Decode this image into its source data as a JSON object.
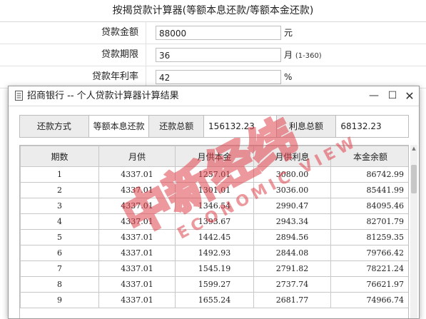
{
  "page": {
    "title": "按揭贷款计算器(等额本息还款/等额本金还款)"
  },
  "form": {
    "amount": {
      "label": "贷款金额",
      "value": "88000",
      "unit": "元"
    },
    "term": {
      "label": "贷款期限",
      "value": "36",
      "unit": "月",
      "hint": "(1-360)"
    },
    "rate": {
      "label": "贷款年利率",
      "value": "42",
      "unit": "%"
    }
  },
  "dialog": {
    "title": "招商银行 -- 个人贷款计算器计算结果",
    "minimize": "—",
    "maximize": "☐",
    "close": "✕",
    "summary": {
      "method_label": "还款方式",
      "method_value": "等额本息还款",
      "total_label": "还款总额",
      "total_value": "156132.23",
      "interest_label": "利息总额",
      "interest_value": "68132.23"
    },
    "table": {
      "headers": [
        "期数",
        "月供",
        "月供本金",
        "月供利息",
        "本金余额"
      ],
      "rows": [
        [
          "1",
          "4337.01",
          "1257.01",
          "3080.00",
          "86742.99"
        ],
        [
          "2",
          "4337.01",
          "1301.01",
          "3036.00",
          "85441.99"
        ],
        [
          "3",
          "4337.01",
          "1346.54",
          "2990.47",
          "84095.46"
        ],
        [
          "4",
          "4337.01",
          "1393.67",
          "2943.34",
          "82701.79"
        ],
        [
          "5",
          "4337.01",
          "1442.45",
          "2894.56",
          "81259.35"
        ],
        [
          "6",
          "4337.01",
          "1492.93",
          "2844.08",
          "79766.42"
        ],
        [
          "7",
          "4337.01",
          "1545.19",
          "2791.82",
          "78221.24"
        ],
        [
          "8",
          "4337.01",
          "1599.27",
          "2737.74",
          "76621.97"
        ],
        [
          "9",
          "4337.01",
          "1655.24",
          "2681.77",
          "74966.74"
        ]
      ]
    }
  },
  "watermark": {
    "chinese": "中新经纬",
    "english": "ECONOMIC VIEW",
    "color": "#e0444e"
  }
}
